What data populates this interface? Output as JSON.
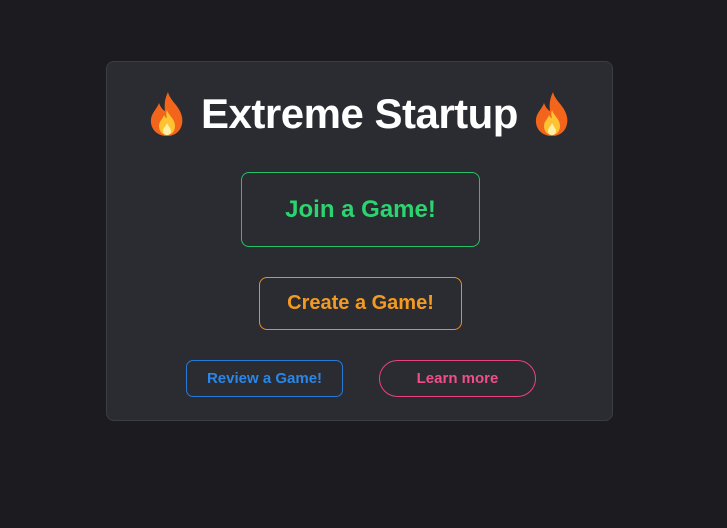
{
  "header": {
    "title": "Extreme Startup",
    "left_icon": "fire-icon",
    "right_icon": "fire-icon"
  },
  "actions": {
    "join_label": "Join a Game!",
    "create_label": "Create a Game!",
    "review_label": "Review a Game!",
    "learn_label": "Learn more"
  },
  "colors": {
    "page_background": "#1c1c20",
    "card_background": "#2b2c31",
    "join": "#2bd46f",
    "create": "#f29a22",
    "review": "#2a86e8",
    "learn": "#ee4f8b",
    "title": "#ffffff"
  }
}
